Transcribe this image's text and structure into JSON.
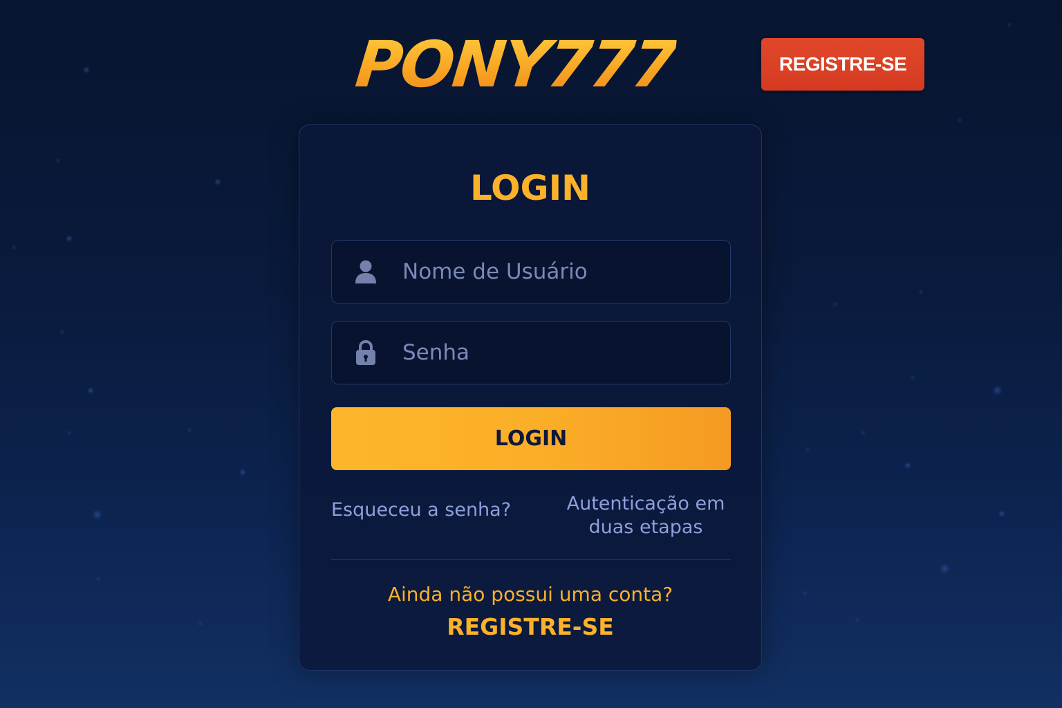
{
  "brand": {
    "logo_text": "PONY777",
    "accent_color": "#fbb12a",
    "register_button_color": "#d94126"
  },
  "header": {
    "register_label": "REGISTRE-SE"
  },
  "login_form": {
    "title": "LOGIN",
    "username": {
      "placeholder": "Nome de Usuário",
      "value": "",
      "icon": "user-icon"
    },
    "password": {
      "placeholder": "Senha",
      "value": "",
      "icon": "lock-icon"
    },
    "submit_label": "LOGIN",
    "forgot_password_label": "Esqueceu a senha?",
    "two_factor_label": "Autenticação em duas etapas",
    "no_account_text": "Ainda não possui uma conta?",
    "register_link_label": "REGISTRE-SE"
  }
}
